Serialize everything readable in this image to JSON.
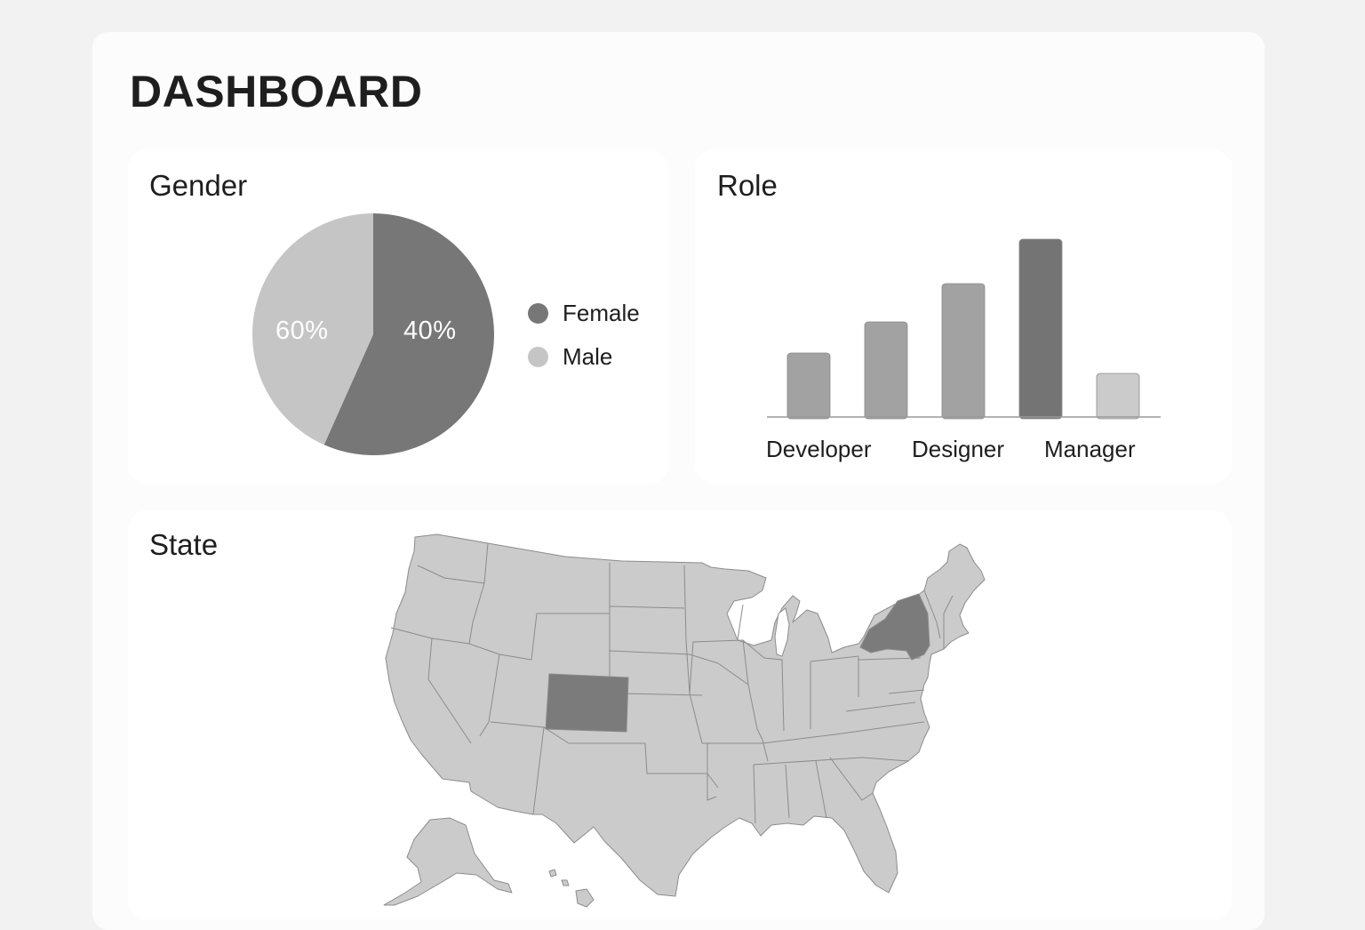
{
  "dashboard": {
    "title": "DASHBOARD"
  },
  "gender": {
    "title": "Gender",
    "chart_data": {
      "type": "pie",
      "slices": [
        {
          "label": "Female",
          "printed_value": "40%",
          "color": "#777777"
        },
        {
          "label": "Male",
          "printed_value": "60%",
          "color": "#c5c5c5"
        }
      ],
      "legend_position": "right"
    }
  },
  "role": {
    "title": "Role",
    "chart_data": {
      "type": "bar",
      "categories": [
        "Developer",
        "",
        "Designer",
        "",
        "Manager"
      ],
      "values": [
        72,
        107,
        150,
        200,
        49
      ],
      "colors": [
        "#a2a2a2",
        "#a2a2a2",
        "#a2a2a2",
        "#747474",
        "#cbcbcb"
      ],
      "ylim": [
        0,
        210
      ],
      "grid": false
    }
  },
  "state": {
    "title": "State",
    "highlighted_states": [
      "Colorado",
      "New York"
    ],
    "colors": {
      "base": "#cbcbcb",
      "highlight": "#7b7b7b",
      "border": "#8c8c8c"
    }
  }
}
